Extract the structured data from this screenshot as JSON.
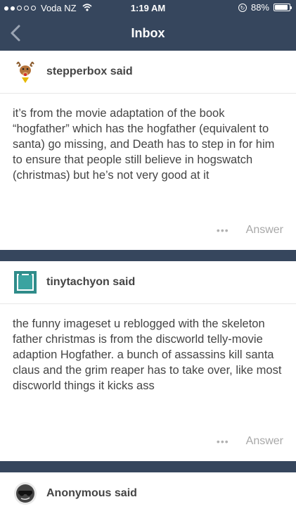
{
  "status_bar": {
    "carrier": "Voda NZ",
    "time": "1:19 AM",
    "battery": "88%",
    "battery_level": 0.88
  },
  "nav": {
    "title": "Inbox"
  },
  "questions": [
    {
      "asker": "stepperbox said",
      "avatar": "reindeer-avatar",
      "text": "it’s from the movie adaptation of the book “hogfather” which has the hogfather (equivalent to santa) go missing, and Death has to step in for him to ensure that people still believe in hogswatch (christmas) but he’s not very good at it",
      "more": "•••",
      "answer": "Answer"
    },
    {
      "asker": "tinytachyon said",
      "avatar": "teal-square-avatar",
      "text": "the funny imageset u reblogged with the skeleton father christmas is from the discworld telly-movie adaption Hogfather. a bunch of assassins kill santa claus and the grim reaper has to take over, like most discworld things it kicks ass",
      "more": "•••",
      "answer": "Answer"
    },
    {
      "asker": "Anonymous said",
      "avatar": "anonymous-avatar"
    }
  ],
  "colors": {
    "tumblr_blue": "#36465d",
    "text": "#444444",
    "muted": "#a8a8a8"
  }
}
